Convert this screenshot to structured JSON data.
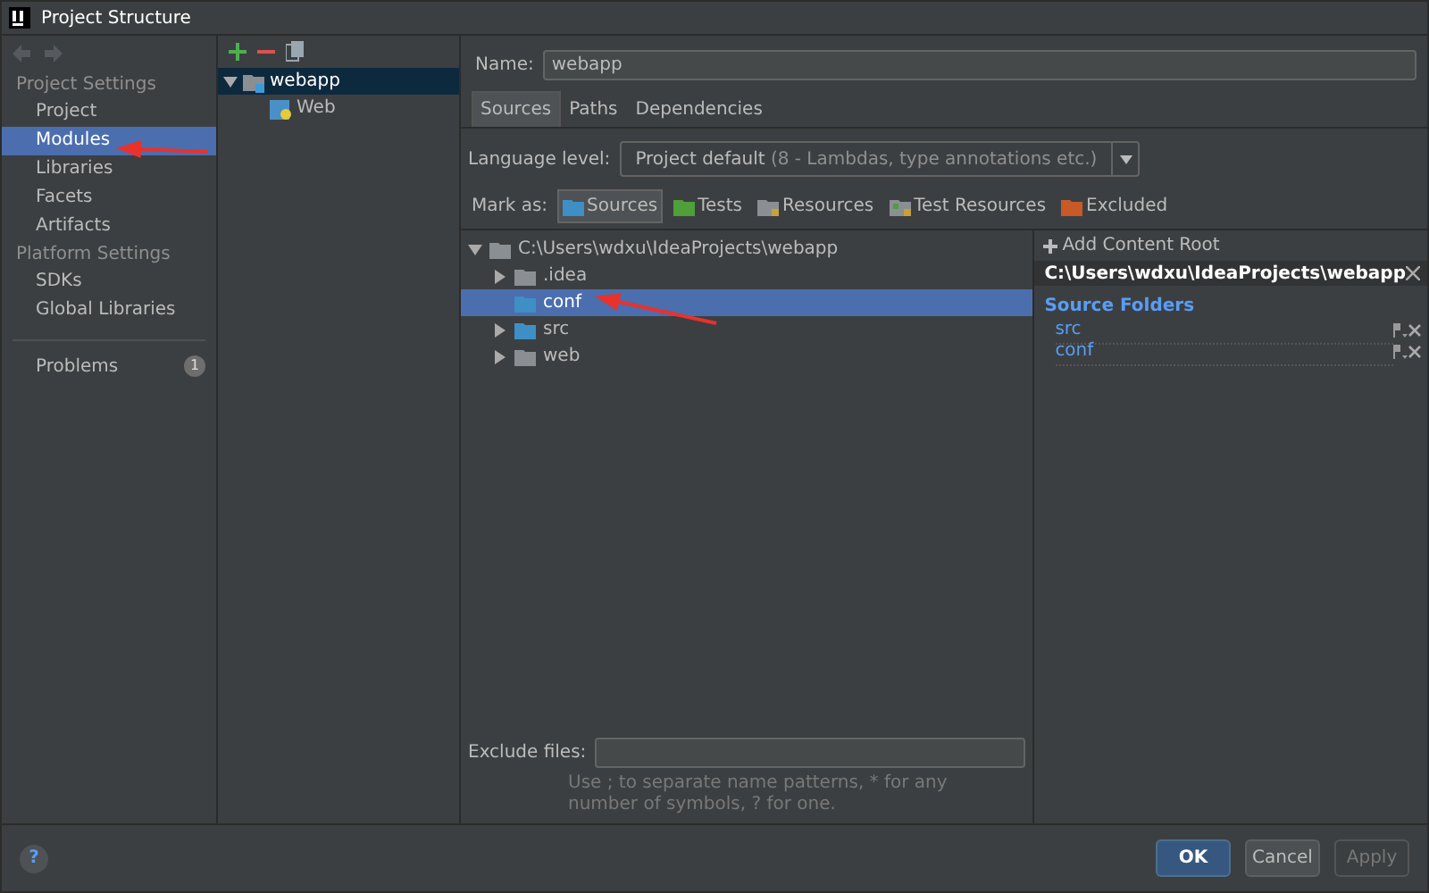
{
  "window": {
    "title": "Project Structure"
  },
  "sidebar": {
    "sections": [
      {
        "heading": "Project Settings",
        "items": [
          {
            "label": "Project",
            "selected": false
          },
          {
            "label": "Modules",
            "selected": true
          },
          {
            "label": "Libraries",
            "selected": false
          },
          {
            "label": "Facets",
            "selected": false
          },
          {
            "label": "Artifacts",
            "selected": false
          }
        ]
      },
      {
        "heading": "Platform Settings",
        "items": [
          {
            "label": "SDKs",
            "selected": false
          },
          {
            "label": "Global Libraries",
            "selected": false
          }
        ]
      }
    ],
    "problems": {
      "label": "Problems",
      "count": "1"
    }
  },
  "module_tree": {
    "items": [
      {
        "label": "webapp",
        "kind": "module",
        "selected": true,
        "expanded": true,
        "children": [
          {
            "label": "Web",
            "kind": "facet",
            "selected": false
          }
        ]
      }
    ]
  },
  "name_field": {
    "label": "Name:",
    "value": "webapp"
  },
  "tabs": [
    {
      "label": "Sources",
      "selected": true
    },
    {
      "label": "Paths",
      "selected": false
    },
    {
      "label": "Dependencies",
      "selected": false
    }
  ],
  "language_level": {
    "label": "Language level:",
    "value": "Project default",
    "hint": "(8 - Lambdas, type annotations etc.)"
  },
  "mark_as": {
    "label": "Mark as:",
    "options": [
      {
        "label": "Sources",
        "kind": "sources",
        "selected": true
      },
      {
        "label": "Tests",
        "kind": "tests",
        "selected": false
      },
      {
        "label": "Resources",
        "kind": "resources",
        "selected": false
      },
      {
        "label": "Test Resources",
        "kind": "test-resources",
        "selected": false
      },
      {
        "label": "Excluded",
        "kind": "excluded",
        "selected": false
      }
    ]
  },
  "content_tree": {
    "label": "C:\\Users\\wdxu\\IdeaProjects\\webapp",
    "expanded": true,
    "children": [
      {
        "label": ".idea",
        "kind": "plain",
        "has_children": true,
        "selected": false
      },
      {
        "label": "conf",
        "kind": "sources",
        "has_children": false,
        "selected": true
      },
      {
        "label": "src",
        "kind": "sources",
        "has_children": true,
        "selected": false
      },
      {
        "label": "web",
        "kind": "plain",
        "has_children": true,
        "selected": false
      }
    ]
  },
  "content_root": {
    "add_label": "Add Content Root",
    "path": "C:\\Users\\wdxu\\IdeaProjects\\webapp",
    "section": "Source Folders",
    "folders": [
      "src",
      "conf"
    ]
  },
  "exclude_files": {
    "label": "Exclude files:",
    "hint": "Use ; to separate name patterns, * for any number of symbols, ? for one."
  },
  "help": {
    "label": "?"
  },
  "buttons": [
    {
      "label": "OK",
      "kind": "primary"
    },
    {
      "label": "Cancel",
      "kind": "default"
    },
    {
      "label": "Apply",
      "kind": "disabled"
    }
  ]
}
